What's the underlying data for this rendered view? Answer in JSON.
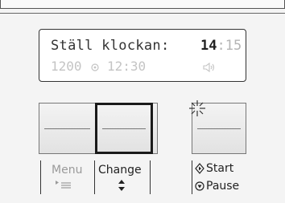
{
  "display": {
    "line1_text": "Ställ klockan:",
    "clock_hours": "14",
    "clock_separator": ":",
    "clock_minutes": "15",
    "line2_left": "1200",
    "line2_right": "12:30"
  },
  "buttons": {
    "menu_label": "Menu",
    "change_label": "Change",
    "start_label": "Start",
    "pause_label": "Pause"
  },
  "colors": {
    "selected_border": "#1a1a1a",
    "dimmed_text": "#9a9a9a"
  },
  "icons": {
    "menu": "menu-arrow-icon",
    "change": "up-down-arrows-icon",
    "start": "start-diamond-icon",
    "pause": "pause-circle-icon",
    "sound": "speaker-icon",
    "timer": "circle-dot-icon",
    "flash": "blink-star-icon"
  }
}
